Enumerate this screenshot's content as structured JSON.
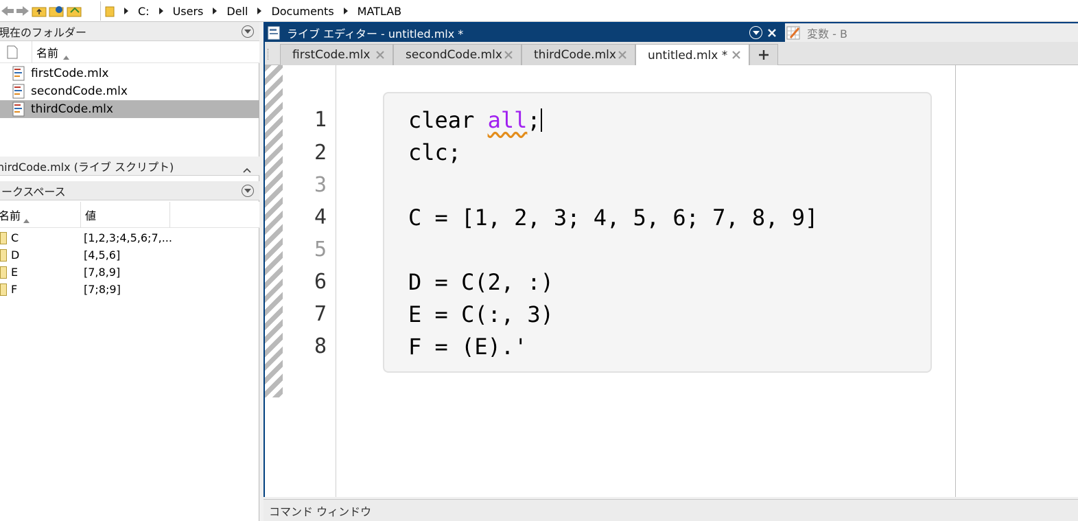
{
  "address_bar": {
    "breadcrumb": [
      "C:",
      "Users",
      "Dell",
      "Documents",
      "MATLAB"
    ]
  },
  "current_folder": {
    "title": "現在のフォルダー",
    "column_name": "名前",
    "files": [
      {
        "name": "firstCode.mlx",
        "selected": false
      },
      {
        "name": "secondCode.mlx",
        "selected": false
      },
      {
        "name": "thirdCode.mlx",
        "selected": true
      }
    ]
  },
  "details": {
    "title": "hirdCode.mlx  (ライブ スクリプト)"
  },
  "workspace": {
    "title": "ワークスペース",
    "col_name": "名前",
    "col_value": "値",
    "variables": [
      {
        "name": "C",
        "value": "[1,2,3;4,5,6;7,..."
      },
      {
        "name": "D",
        "value": "[4,5,6]"
      },
      {
        "name": "E",
        "value": "[7,8,9]"
      },
      {
        "name": "F",
        "value": "[7;8;9]"
      }
    ]
  },
  "editor": {
    "title": "ライブ エディター - untitled.mlx *",
    "variable_tab": "変数 - B",
    "tabs": [
      {
        "label": "firstCode.mlx",
        "active": false
      },
      {
        "label": "secondCode.mlx",
        "active": false
      },
      {
        "label": "thirdCode.mlx",
        "active": false
      },
      {
        "label": "untitled.mlx *",
        "active": true
      }
    ],
    "line_numbers": [
      "1",
      "2",
      "3",
      "4",
      "5",
      "6",
      "7",
      "8"
    ],
    "code": {
      "line1_a": "clear ",
      "line1_b": "all",
      "line1_c": ";",
      "line2": "clc;",
      "line3": "",
      "line4": "C = [1, 2, 3; 4, 5, 6; 7, 8, 9]",
      "line5": "",
      "line6": "D = C(2, :)",
      "line7": "E = C(:, 3)",
      "line8": "F = (E).'"
    }
  },
  "command_window": {
    "title": "コマンド ウィンドウ"
  },
  "colors": {
    "title_bar": "#0b3f74",
    "keyword": "#a020f0",
    "selection": "#b4b4b4"
  }
}
